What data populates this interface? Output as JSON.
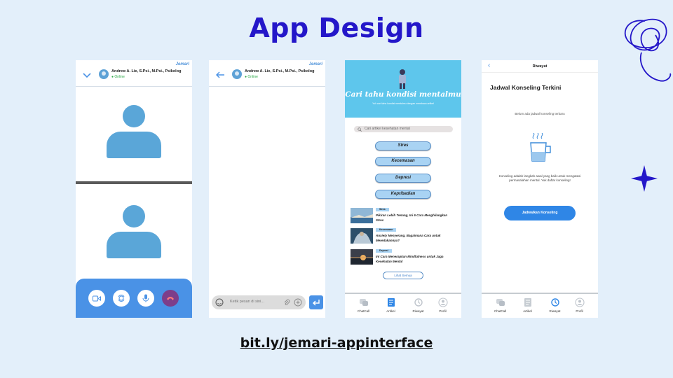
{
  "slide": {
    "title": "App Design",
    "link": "bit.ly/jemari-appinterface",
    "accent": "#2417c9"
  },
  "common": {
    "brand": "Jemari",
    "contact_name": "Andrew A. Lie, S.Psi., M.Psi., Psikolog",
    "contact_status": "Online"
  },
  "call": {
    "buttons": [
      "video-camera-icon",
      "switch-camera-icon",
      "microphone-icon",
      "end-call-icon"
    ]
  },
  "chat": {
    "input_placeholder": "Ketik pesan di sini..."
  },
  "articles": {
    "hero_title": "Cari tahu kondisi mentalmu",
    "hero_subtitle": "Yuk cari tahu kondisi mentalmu dengan membaca artikel",
    "search_placeholder": "Cari artikel kesehatan mental",
    "categories": [
      "Stres",
      "Kecemasan",
      "Depresi",
      "Kepribadian"
    ],
    "items": [
      {
        "tag": "Stres",
        "title": "Pikiran Lebih Tenang, Ini 6 Cara Menghilangkan Stres"
      },
      {
        "tag": "Kecemasan",
        "title": "Anxiety Menyerang, Bagaimana Cara untuk Meredakannya?"
      },
      {
        "tag": "Depresi",
        "title": "Ini Cara Menerapkan Mindfulness untuk Jaga Kesehatan Mental"
      }
    ],
    "see_all": "Lihat Semua"
  },
  "nav": {
    "items": [
      "ChatCall",
      "Artikel",
      "Riwayat",
      "Profil"
    ]
  },
  "history": {
    "header": "Riwayat",
    "section_title": "Jadwal Konseling Terkini",
    "empty_text": "Belum ada jadwal konseling terbaru",
    "paragraph": "Konseling adalah langkah awal yang baik untuk mengatasi permasalahan mental. Yuk daftar konseling!",
    "button": "Jadwalkan Konseling"
  }
}
